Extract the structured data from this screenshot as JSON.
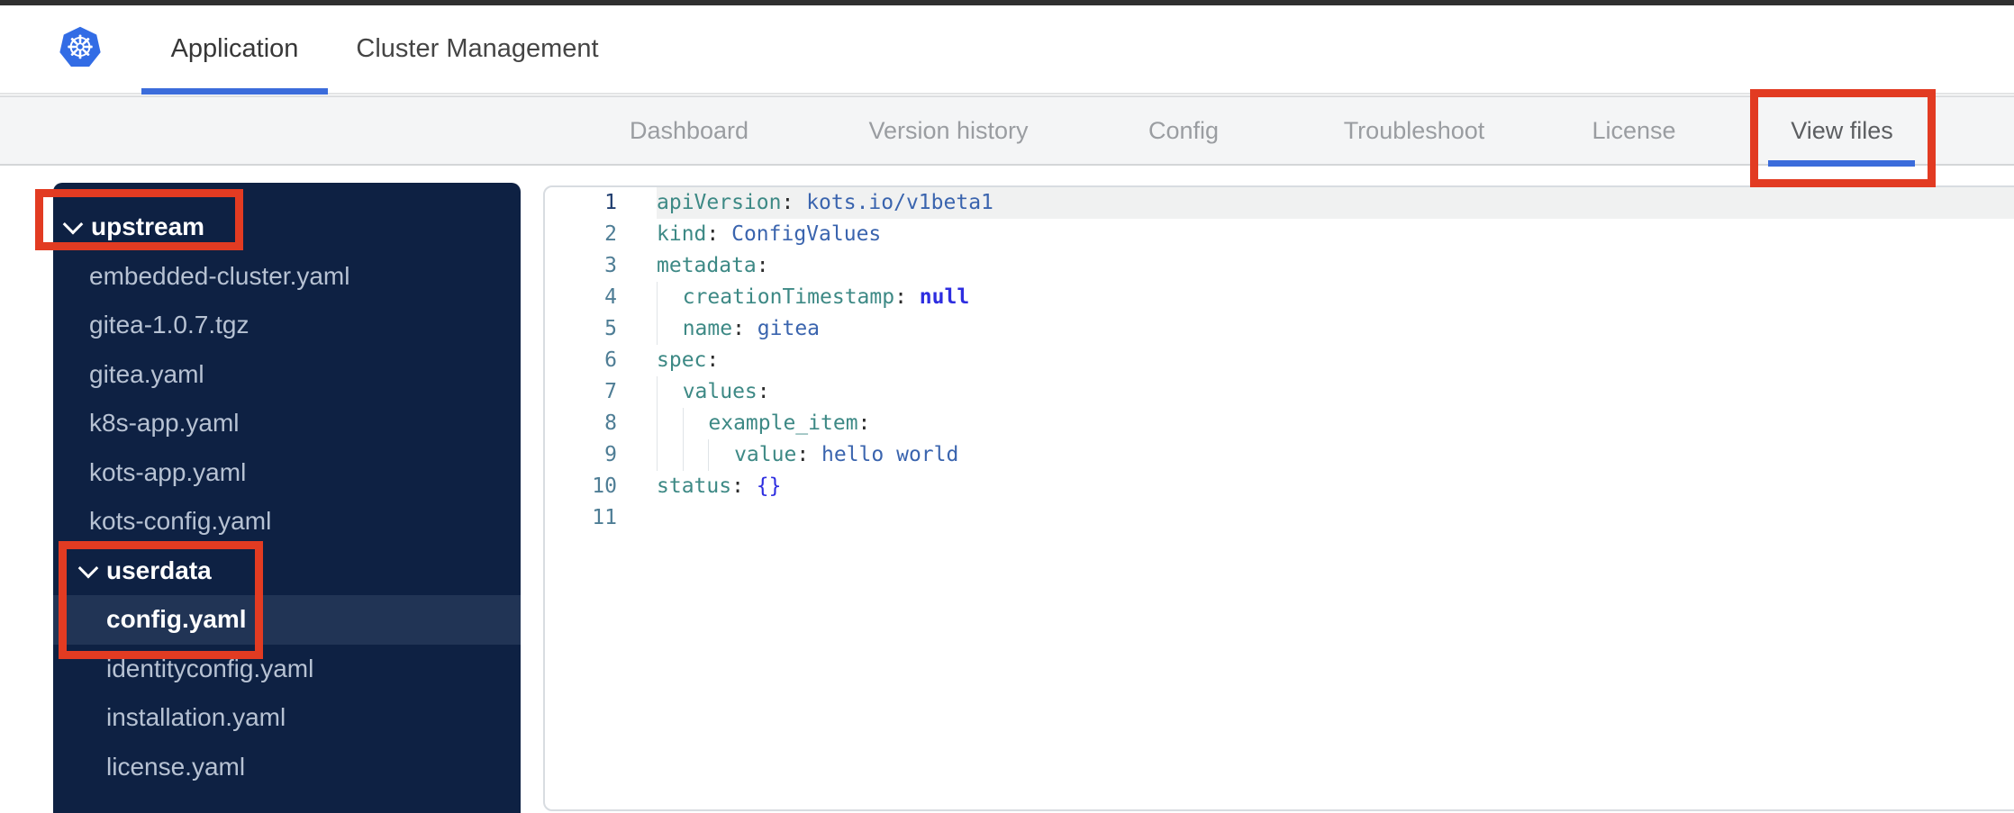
{
  "header": {
    "logo_icon": "kubernetes-wheel-icon",
    "tabs": [
      {
        "label": "Application",
        "active": true
      },
      {
        "label": "Cluster Management",
        "active": false
      }
    ]
  },
  "subnav": {
    "tabs": [
      {
        "label": "Dashboard",
        "active": false
      },
      {
        "label": "Version history",
        "active": false
      },
      {
        "label": "Config",
        "active": false
      },
      {
        "label": "Troubleshoot",
        "active": false
      },
      {
        "label": "License",
        "active": false
      },
      {
        "label": "View files",
        "active": true
      }
    ]
  },
  "file_tree": {
    "items": [
      {
        "label": "upstream",
        "kind": "folder",
        "level": 0,
        "expanded": true,
        "selected": false
      },
      {
        "label": "embedded-cluster.yaml",
        "kind": "file",
        "level": 1,
        "selected": false
      },
      {
        "label": "gitea-1.0.7.tgz",
        "kind": "file",
        "level": 1,
        "selected": false
      },
      {
        "label": "gitea.yaml",
        "kind": "file",
        "level": 1,
        "selected": false
      },
      {
        "label": "k8s-app.yaml",
        "kind": "file",
        "level": 1,
        "selected": false
      },
      {
        "label": "kots-app.yaml",
        "kind": "file",
        "level": 1,
        "selected": false
      },
      {
        "label": "kots-config.yaml",
        "kind": "file",
        "level": 1,
        "selected": false
      },
      {
        "label": "userdata",
        "kind": "folder",
        "level": 1,
        "expanded": true,
        "selected": false
      },
      {
        "label": "config.yaml",
        "kind": "file",
        "level": 2,
        "selected": true
      },
      {
        "label": "identityconfig.yaml",
        "kind": "file",
        "level": 2,
        "selected": false
      },
      {
        "label": "installation.yaml",
        "kind": "file",
        "level": 2,
        "selected": false
      },
      {
        "label": "license.yaml",
        "kind": "file",
        "level": 2,
        "selected": false
      }
    ]
  },
  "editor": {
    "language": "yaml",
    "active_line": 1,
    "lines": [
      {
        "n": 1,
        "ind": 0,
        "tokens": [
          {
            "c": "key",
            "t": "apiVersion"
          },
          {
            "c": "pun",
            "t": ": "
          },
          {
            "c": "str",
            "t": "kots.io/v1beta1"
          }
        ]
      },
      {
        "n": 2,
        "ind": 0,
        "tokens": [
          {
            "c": "key",
            "t": "kind"
          },
          {
            "c": "pun",
            "t": ": "
          },
          {
            "c": "str",
            "t": "ConfigValues"
          }
        ]
      },
      {
        "n": 3,
        "ind": 0,
        "tokens": [
          {
            "c": "key",
            "t": "metadata"
          },
          {
            "c": "pun",
            "t": ":"
          }
        ]
      },
      {
        "n": 4,
        "ind": 1,
        "tokens": [
          {
            "c": "key",
            "t": "creationTimestamp"
          },
          {
            "c": "pun",
            "t": ": "
          },
          {
            "c": "kw",
            "t": "null"
          }
        ]
      },
      {
        "n": 5,
        "ind": 1,
        "tokens": [
          {
            "c": "key",
            "t": "name"
          },
          {
            "c": "pun",
            "t": ": "
          },
          {
            "c": "str",
            "t": "gitea"
          }
        ]
      },
      {
        "n": 6,
        "ind": 0,
        "tokens": [
          {
            "c": "key",
            "t": "spec"
          },
          {
            "c": "pun",
            "t": ":"
          }
        ]
      },
      {
        "n": 7,
        "ind": 1,
        "tokens": [
          {
            "c": "key",
            "t": "values"
          },
          {
            "c": "pun",
            "t": ":"
          }
        ]
      },
      {
        "n": 8,
        "ind": 2,
        "tokens": [
          {
            "c": "key",
            "t": "example_item"
          },
          {
            "c": "pun",
            "t": ":"
          }
        ]
      },
      {
        "n": 9,
        "ind": 3,
        "tokens": [
          {
            "c": "key",
            "t": "value"
          },
          {
            "c": "pun",
            "t": ": "
          },
          {
            "c": "str",
            "t": "hello world"
          }
        ]
      },
      {
        "n": 10,
        "ind": 0,
        "tokens": [
          {
            "c": "key",
            "t": "status"
          },
          {
            "c": "pun",
            "t": ": "
          },
          {
            "c": "kw2",
            "t": "{}"
          }
        ]
      },
      {
        "n": 11,
        "ind": 0,
        "tokens": []
      }
    ]
  },
  "annotations": {
    "color": "#e23b22",
    "boxes": [
      "view-files-tab",
      "upstream-folder",
      "userdata-and-config-yaml"
    ]
  },
  "colors": {
    "kubernetes_blue": "#326ce5",
    "accent_underline_blue": "#3b6cdb",
    "annotation_red": "#e23b22",
    "sidebar_bg": "#0e2143",
    "sidebar_selected_bg": "#213455",
    "sidebar_file_text": "#b7c2d3",
    "subnav_bg": "#f4f5f6",
    "syntax_key_teal": "#3d8985",
    "syntax_value_blue": "#3a64ae",
    "syntax_keyword_blue": "#2d2de0",
    "gutter_number": "#4e7d95",
    "active_line_bg": "#f0f1f1"
  }
}
